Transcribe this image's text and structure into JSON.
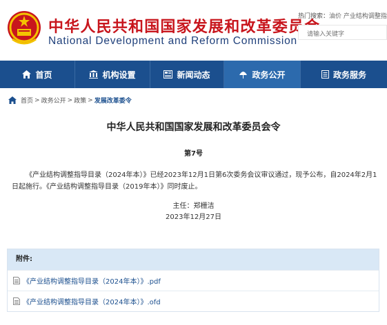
{
  "header": {
    "title_cn": "中华人民共和国国家发展和改革委员会",
    "title_en": "National Development and Reform Commission",
    "hot_label": "热门搜索：",
    "hot_items": "油价  产业结构调整指导",
    "search_placeholder": "请输入关键字"
  },
  "nav": {
    "items": [
      {
        "label": "首页",
        "icon": "home-icon"
      },
      {
        "label": "机构设置",
        "icon": "building-icon"
      },
      {
        "label": "新闻动态",
        "icon": "newspaper-icon"
      },
      {
        "label": "政务公开",
        "icon": "globe-icon",
        "active": true
      },
      {
        "label": "政务服务",
        "icon": "document-icon"
      }
    ]
  },
  "breadcrumb": {
    "home": "首页",
    "level1": "政务公开",
    "level2": "政策",
    "current": "发展改革委令"
  },
  "document": {
    "title": "中华人民共和国国家发展和改革委员会令",
    "number": "第7号",
    "body": "《产业结构调整指导目录（2024年本）》已经2023年12月1日第6次委务会议审议通过，现予公布，自2024年2月1日起施行。《产业结构调整指导目录（2019年本）》同时废止。",
    "signer": "主任：郑栅洁",
    "date": "2023年12月27日"
  },
  "attachments": {
    "heading": "附件:",
    "files": [
      {
        "name": "《产业结构调整指导目录（2024年本）》.pdf"
      },
      {
        "name": "《产业结构调整指导目录（2024年本）》.ofd"
      }
    ]
  },
  "colors": {
    "brand_red": "#c8161d",
    "nav_blue": "#1b4f8e",
    "nav_active": "#2c6aad",
    "attach_head_bg": "#d9e8f6"
  }
}
